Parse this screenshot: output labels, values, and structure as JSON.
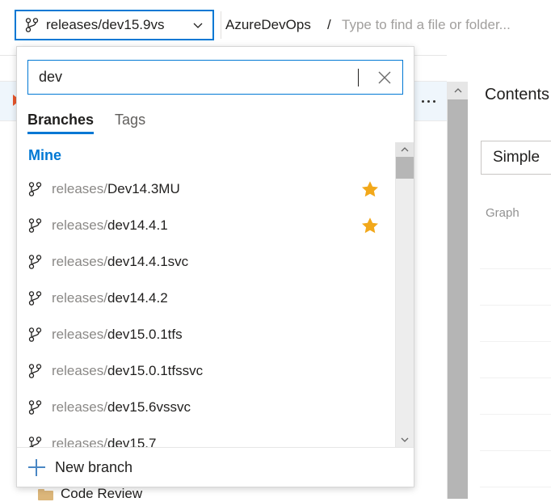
{
  "topbar": {
    "branch_picker": {
      "icon": "branch-icon",
      "value": "releases/dev15.9vs",
      "chevron": "chevron-down-icon"
    },
    "breadcrumb": {
      "repo": "AzureDevOps",
      "separator": "/",
      "path_placeholder": "Type to find a file or folder..."
    }
  },
  "popup": {
    "search": {
      "value": "dev",
      "placeholder": "",
      "clear_icon": "close-icon"
    },
    "tabs": [
      {
        "label": "Branches",
        "active": true
      },
      {
        "label": "Tags",
        "active": false
      }
    ],
    "group_header": "Mine",
    "branches": [
      {
        "prefix": "releases/",
        "match": "Dev14.3MU",
        "favorite": true
      },
      {
        "prefix": "releases/",
        "match": "dev14.4.1",
        "favorite": true
      },
      {
        "prefix": "releases/",
        "match": "dev14.4.1svc",
        "favorite": false
      },
      {
        "prefix": "releases/",
        "match": "dev14.4.2",
        "favorite": false
      },
      {
        "prefix": "releases/",
        "match": "dev15.0.1tfs",
        "favorite": false
      },
      {
        "prefix": "releases/",
        "match": "dev15.0.1tfssvc",
        "favorite": false
      },
      {
        "prefix": "releases/",
        "match": "dev15.6vssvc",
        "favorite": false
      },
      {
        "prefix": "releases/",
        "match": "dev15.7",
        "favorite": false
      }
    ],
    "scrollbar": {
      "up_icon": "chevron-up-icon",
      "down_icon": "chevron-down-icon"
    },
    "footer": {
      "icon": "plus-icon",
      "label": "New branch"
    }
  },
  "background": {
    "overflow_menu_icon": "ellipsis-icon",
    "collapse_icon": "chevron-up-icon",
    "page_scroll_up_icon": "chevron-up-icon",
    "folder_item": {
      "icon": "folder-icon",
      "label": "Code Review"
    }
  },
  "right_panel": {
    "title": "Contents",
    "simple_button": "Simple",
    "graph_label": "Graph"
  },
  "colors": {
    "accent": "#0078d4",
    "favorite_star": "#f2a81a",
    "muted_text": "#8a8886",
    "marker": "#e8562b",
    "folder": "#dcb67a"
  }
}
